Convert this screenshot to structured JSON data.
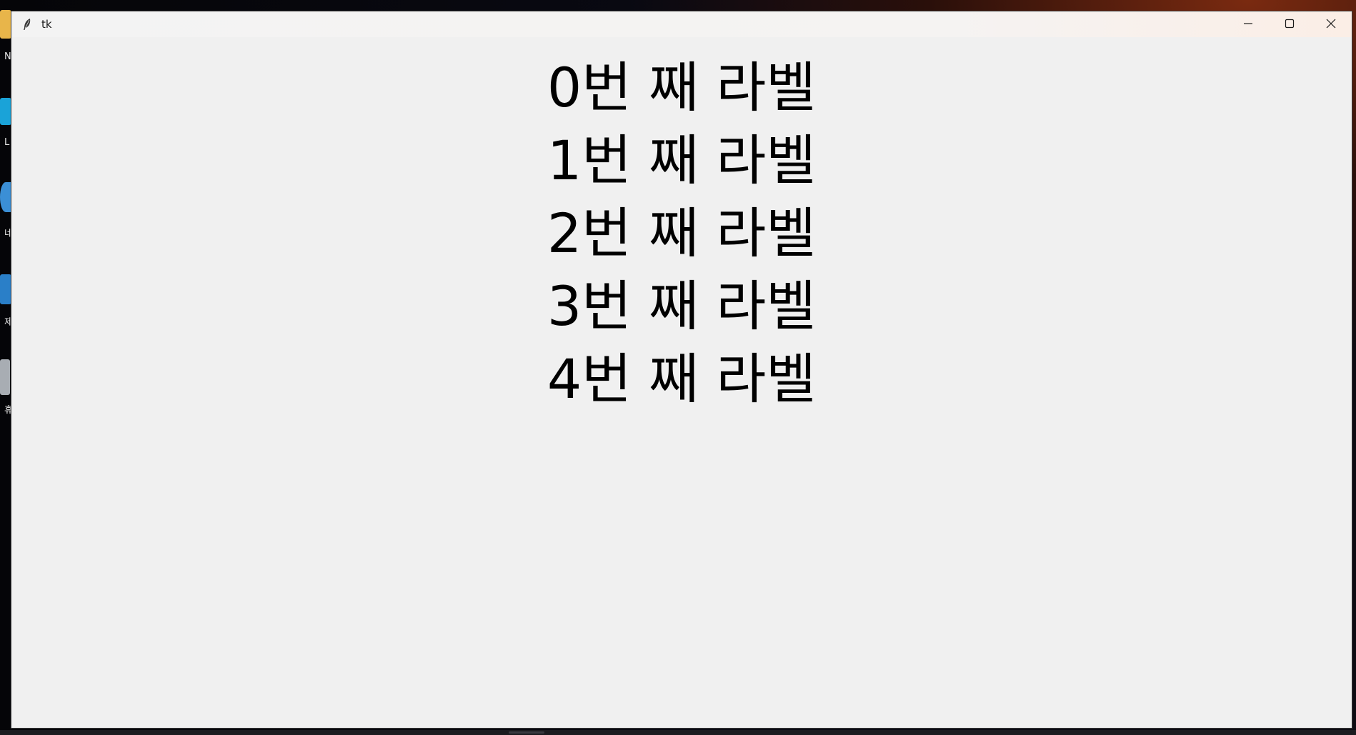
{
  "window": {
    "title": "tk",
    "app_icon": "feather-icon",
    "buttons": {
      "minimize_icon": "minimize-icon",
      "maximize_icon": "maximize-icon",
      "close_icon": "close-icon"
    }
  },
  "labels": [
    "0번 째 라벨",
    "1번 째 라벨",
    "2번 째 라벨",
    "3번 째 라벨",
    "4번 째 라벨"
  ],
  "desktop": {
    "icon_labels": [
      "N",
      "L",
      "네",
      "제",
      "휴"
    ]
  },
  "colors": {
    "window_bg": "#f0f0f0",
    "text": "#000000"
  }
}
